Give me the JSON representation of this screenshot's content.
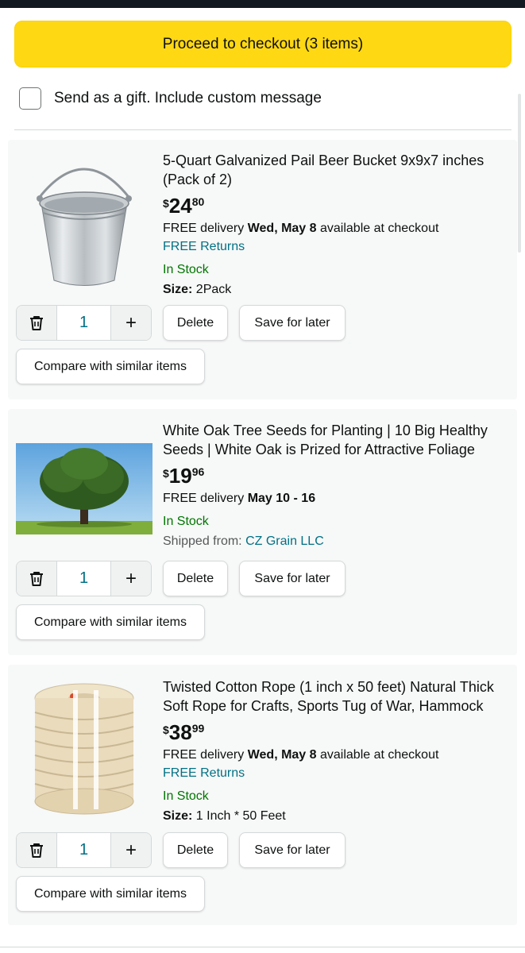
{
  "cart": {
    "checkout_label": "Proceed to checkout (3 items)",
    "gift_label": "Send as a gift. Include custom message"
  },
  "controls": {
    "delete_label": "Delete",
    "save_label": "Save for later",
    "compare_label": "Compare with similar items",
    "delete_icon": "trash-icon",
    "plus_icon": "plus-icon"
  },
  "items": [
    {
      "title": "5-Quart Galvanized Pail Beer Bucket 9x9x7 inches (Pack of 2)",
      "price_symbol": "$",
      "price_whole": "24",
      "price_fraction": "80",
      "delivery_prefix": "FREE delivery ",
      "delivery_date": "Wed, May 8",
      "delivery_suffix": " available at checkout",
      "returns": "FREE Returns",
      "stock": "In Stock",
      "detail_label": "Size:",
      "detail_value": " 2Pack",
      "quantity": "1",
      "image": "galvanized-bucket"
    },
    {
      "title": "White Oak Tree Seeds for Planting | 10 Big Healthy Seeds | White Oak is Prized for Attractive Foliage",
      "price_symbol": "$",
      "price_whole": "19",
      "price_fraction": "96",
      "delivery_prefix": "FREE delivery ",
      "delivery_date": "May 10 - 16",
      "stock": "In Stock",
      "shipped_label": "Shipped from: ",
      "shipped_value": "CZ Grain LLC",
      "quantity": "1",
      "image": "oak-tree"
    },
    {
      "title": "Twisted Cotton Rope (1 inch x 50 feet) Natural Thick Soft Rope for Crafts, Sports Tug of War, Hammock",
      "price_symbol": "$",
      "price_whole": "38",
      "price_fraction": "99",
      "delivery_prefix": "FREE delivery ",
      "delivery_date": "Wed, May 8",
      "delivery_suffix": " available at checkout",
      "returns": "FREE Returns",
      "stock": "In Stock",
      "detail_label": "Size:",
      "detail_value": " 1 Inch * 50 Feet",
      "quantity": "1",
      "image": "cotton-rope"
    }
  ]
}
